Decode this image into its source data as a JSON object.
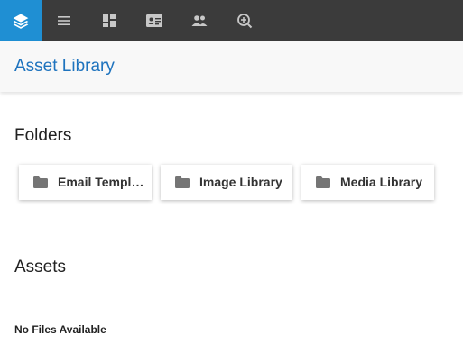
{
  "nav": {
    "items": [
      {
        "icon": "layers-icon",
        "active": true
      },
      {
        "icon": "menu-icon",
        "active": false
      },
      {
        "icon": "dashboard-icon",
        "active": false
      },
      {
        "icon": "contact-card-icon",
        "active": false
      },
      {
        "icon": "people-icon",
        "active": false
      },
      {
        "icon": "zoom-add-icon",
        "active": false
      }
    ]
  },
  "header": {
    "title": "Asset Library"
  },
  "folders": {
    "title": "Folders",
    "items": [
      {
        "label": "Email Templa…",
        "icon": "folder-icon"
      },
      {
        "label": "Image Library",
        "icon": "folder-icon"
      },
      {
        "label": "Media Library",
        "icon": "folder-icon"
      }
    ]
  },
  "assets": {
    "title": "Assets",
    "empty_message": "No Files Available"
  },
  "colors": {
    "nav_bg": "#3b3b3b",
    "nav_active": "#1f8fd3",
    "title_blue": "#1e73be"
  }
}
